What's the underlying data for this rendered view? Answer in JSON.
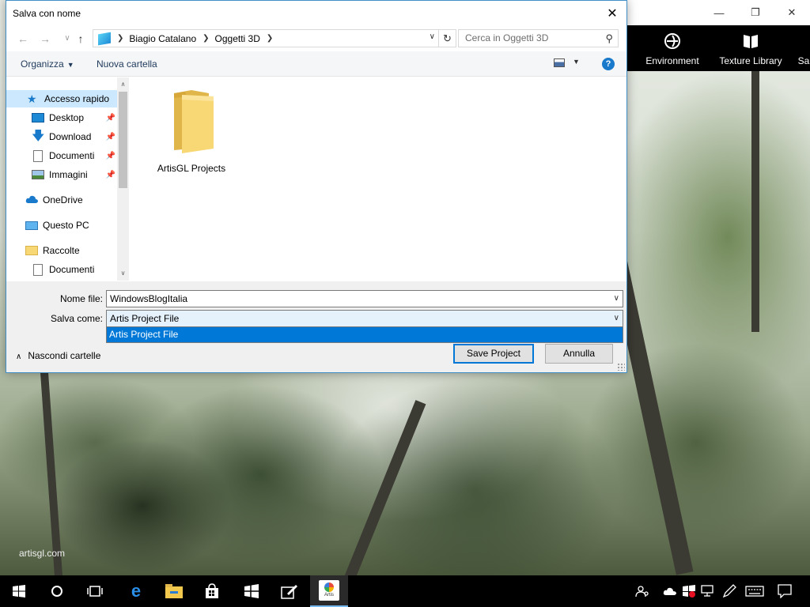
{
  "dialog": {
    "title": "Salva con nome",
    "address": {
      "segments": [
        "Biagio Catalano",
        "Oggetti 3D"
      ]
    },
    "search_placeholder": "Cerca in Oggetti 3D",
    "commands": {
      "organize": "Organizza",
      "new_folder": "Nuova cartella"
    },
    "nav": {
      "quick_access": "Accesso rapido",
      "desktop": "Desktop",
      "download": "Download",
      "documents": "Documenti",
      "images": "Immagini",
      "onedrive": "OneDrive",
      "this_pc": "Questo PC",
      "collections": "Raccolte",
      "collections_documents": "Documenti"
    },
    "files": [
      {
        "name": "ArtisGL Projects",
        "type": "folder"
      }
    ],
    "filename_label": "Nome file:",
    "filename_value": "WindowsBlogItalia",
    "savetype_label": "Salva come:",
    "savetype_value": "Artis Project File",
    "savetype_options": [
      "Artis Project File"
    ],
    "save_button": "Save Project",
    "cancel_button": "Annulla",
    "hide_folders": "Nascondi cartelle"
  },
  "app": {
    "toolbar": {
      "environment": "Environment",
      "texture_library": "Texture Library",
      "partial": "Sa"
    },
    "watermark": "artisgl.com"
  },
  "taskbar": {
    "icons": [
      "windows-start-icon",
      "search-circle-icon",
      "task-view-icon",
      "edge-icon",
      "file-explorer-icon",
      "store-icon",
      "windows-tile-icon",
      "pen-note-icon",
      "artis-app-icon"
    ],
    "artis_label": "Artis",
    "tray_icons": [
      "people-icon",
      "onedrive-cloud-icon",
      "defender-icon",
      "network-icon",
      "pen-workspace-icon",
      "keyboard-icon",
      "action-center-icon"
    ]
  },
  "colors": {
    "accent": "#0078d7",
    "selected_nav": "#cce8ff",
    "folder_yellow": "#f8d775"
  }
}
